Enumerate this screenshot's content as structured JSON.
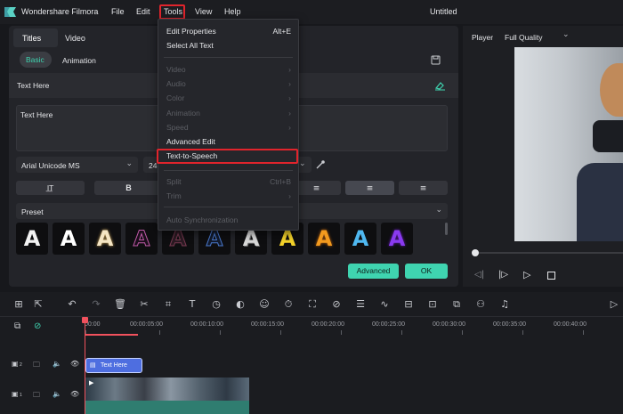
{
  "app": {
    "name": "Wondershare Filmora",
    "project_title": "Untitled"
  },
  "menubar": {
    "items": [
      "File",
      "Edit",
      "Tools",
      "View",
      "Help"
    ]
  },
  "left_panel": {
    "tabs": [
      "Titles",
      "Video"
    ],
    "subtabs": [
      "Basic",
      "Animation"
    ],
    "section_label": "Text Here",
    "textarea_value": "Text Here",
    "font_family": "Arial Unicode MS",
    "font_size": "24",
    "bold_label": "B",
    "preset_label": "Preset",
    "preset_glyph": "A",
    "buttons": {
      "advanced": "Advanced",
      "ok": "OK"
    }
  },
  "tools_menu": {
    "items": [
      {
        "label": "Edit Properties",
        "shortcut": "Alt+E",
        "enabled": true,
        "submenu": false
      },
      {
        "label": "Select All Text",
        "shortcut": "",
        "enabled": true,
        "submenu": false
      },
      {
        "label": "Video",
        "shortcut": "",
        "enabled": false,
        "submenu": true
      },
      {
        "label": "Audio",
        "shortcut": "",
        "enabled": false,
        "submenu": true
      },
      {
        "label": "Color",
        "shortcut": "",
        "enabled": false,
        "submenu": true
      },
      {
        "label": "Animation",
        "shortcut": "",
        "enabled": false,
        "submenu": true
      },
      {
        "label": "Speed",
        "shortcut": "",
        "enabled": false,
        "submenu": true
      },
      {
        "label": "Advanced Edit",
        "shortcut": "",
        "enabled": true,
        "submenu": false
      },
      {
        "label": "Text-to-Speech",
        "shortcut": "",
        "enabled": true,
        "submenu": false,
        "highlighted": true
      },
      {
        "label": "Split",
        "shortcut": "Ctrl+B",
        "enabled": false,
        "submenu": false
      },
      {
        "label": "Trim",
        "shortcut": "",
        "enabled": false,
        "submenu": true
      },
      {
        "label": "Auto Synchronization",
        "shortcut": "",
        "enabled": false,
        "submenu": false
      }
    ],
    "submenu_glyph": "›"
  },
  "player": {
    "label": "Player",
    "quality": "Full Quality"
  },
  "timeline": {
    "ticks": [
      "00:00",
      "00:00:05:00",
      "00:00:10:00",
      "00:00:15:00",
      "00:00:20:00",
      "00:00:25:00",
      "00:00:30:00",
      "00:00:35:00",
      "00:00:40:00"
    ],
    "tracks": [
      {
        "index": "2"
      },
      {
        "index": "1"
      }
    ],
    "text_clip_label": "Text Here"
  },
  "colors": {
    "accent": "#3fd4b0",
    "highlight_border": "#e0242c",
    "playhead": "#f1515d",
    "text_clip": "#4e6ee0"
  },
  "icons": [
    "filmora-logo-icon",
    "chevron-down-icon",
    "save-icon",
    "eyedropper-icon",
    "play-icon",
    "stop-icon",
    "undo-icon",
    "redo-icon",
    "delete-icon",
    "scissors-icon",
    "lock-icon",
    "eye-icon",
    "speaker-icon",
    "folder-icon",
    "link-icon"
  ]
}
